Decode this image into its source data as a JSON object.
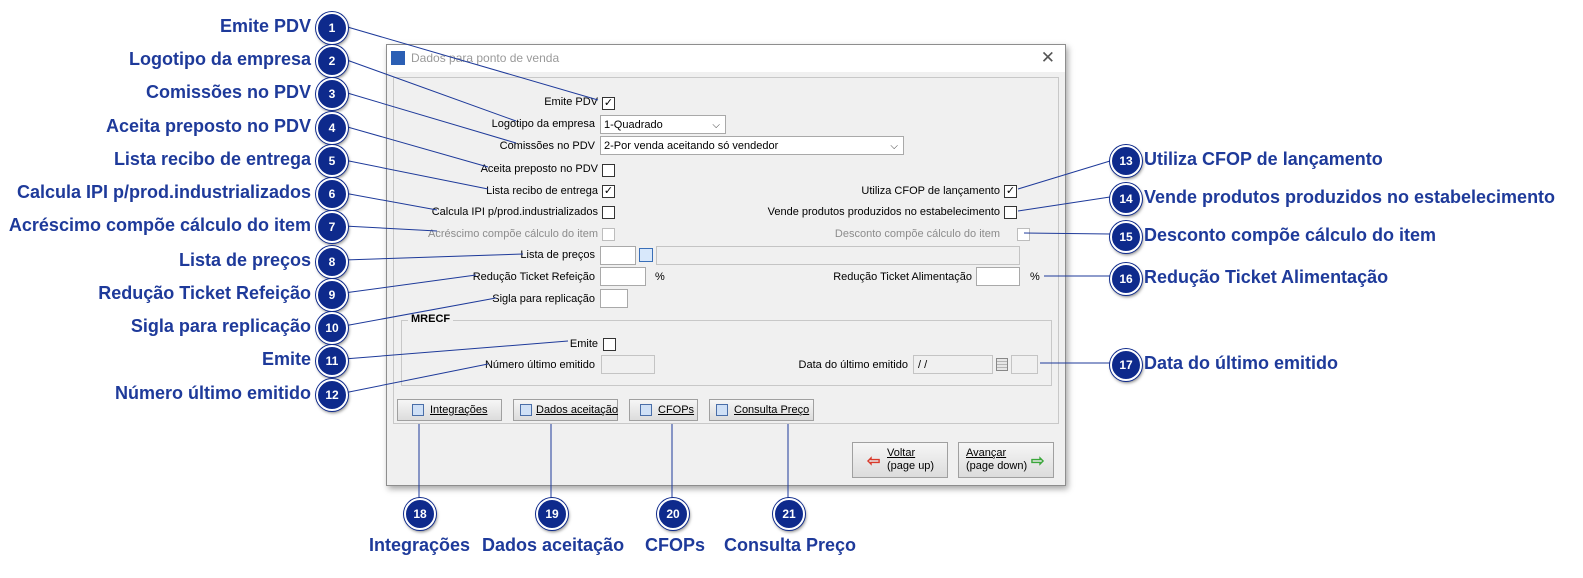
{
  "window": {
    "title": "Dados para ponto de venda",
    "close_glyph": "✕"
  },
  "form": {
    "emite_pdv_label": "Emite PDV",
    "emite_pdv_checked": true,
    "logotipo_label": "Logotipo da empresa",
    "logotipo_value": "1-Quadrado",
    "comissoes_label": "Comissões no PDV",
    "comissoes_value": "2-Por venda aceitando só vendedor",
    "aceita_preposto_label": "Aceita preposto no PDV",
    "aceita_preposto_checked": false,
    "lista_recibo_label": "Lista recibo de entrega",
    "lista_recibo_checked": true,
    "calcula_ipi_label": "Calcula IPI p/prod.industrializados",
    "calcula_ipi_checked": false,
    "acrescimo_label": "Acréscimo compõe cálculo do item",
    "acrescimo_checked": false,
    "lista_precos_label": "Lista de preços",
    "lista_precos_value": "",
    "reducao_refeicao_label": "Redução Ticket Refeição",
    "reducao_refeicao_value": "",
    "percent": "%",
    "sigla_label": "Sigla para replicação",
    "sigla_value": "",
    "utiliza_cfop_label": "Utiliza CFOP de lançamento",
    "utiliza_cfop_checked": true,
    "vende_produtos_label": "Vende produtos produzidos no estabelecimento",
    "vende_produtos_checked": false,
    "desconto_label": "Desconto compõe cálculo do item",
    "desconto_checked": false,
    "reducao_alimentacao_label": "Redução Ticket Alimentação",
    "reducao_alimentacao_value": ""
  },
  "mrecf": {
    "title": "MRECF",
    "emite_label": "Emite",
    "emite_checked": false,
    "numero_label": "Número último emitido",
    "numero_value": "",
    "data_label": "Data do último emitido",
    "data_value": "/ /"
  },
  "buttons": {
    "integracoes": "Integrações",
    "dados_aceitacao": "Dados aceitação",
    "cfops": "CFOPs",
    "consulta_preco": "Consulta Preço",
    "voltar_line1": "Voltar",
    "voltar_line2": "(page up)",
    "avancar_line1": "Avançar",
    "avancar_line2": "(page down)"
  },
  "callouts": [
    {
      "num": "1",
      "text": "Emite PDV"
    },
    {
      "num": "2",
      "text": "Logotipo da empresa"
    },
    {
      "num": "3",
      "text": "Comissões no PDV"
    },
    {
      "num": "4",
      "text": "Aceita preposto no PDV"
    },
    {
      "num": "5",
      "text": "Lista recibo de entrega"
    },
    {
      "num": "6",
      "text": "Calcula IPI p/prod.industrializados"
    },
    {
      "num": "7",
      "text": "Acréscimo compõe cálculo do item"
    },
    {
      "num": "8",
      "text": "Lista de preços"
    },
    {
      "num": "9",
      "text": "Redução Ticket Refeição"
    },
    {
      "num": "10",
      "text": "Sigla para replicação"
    },
    {
      "num": "11",
      "text": "Emite"
    },
    {
      "num": "12",
      "text": "Número último emitido"
    },
    {
      "num": "13",
      "text": "Utiliza CFOP de lançamento"
    },
    {
      "num": "14",
      "text": "Vende produtos produzidos no estabelecimento"
    },
    {
      "num": "15",
      "text": "Desconto compõe cálculo do item"
    },
    {
      "num": "16",
      "text": "Redução Ticket Alimentação"
    },
    {
      "num": "17",
      "text": "Data do último emitido"
    },
    {
      "num": "18",
      "text": "Integrações"
    },
    {
      "num": "19",
      "text": "Dados aceitação"
    },
    {
      "num": "20",
      "text": "CFOPs"
    },
    {
      "num": "21",
      "text": "Consulta Preço"
    }
  ],
  "colors": {
    "callout_text": "#1e3a9a",
    "badge": "#0e2a8c",
    "dialog_bg": "#f0f0f0"
  }
}
